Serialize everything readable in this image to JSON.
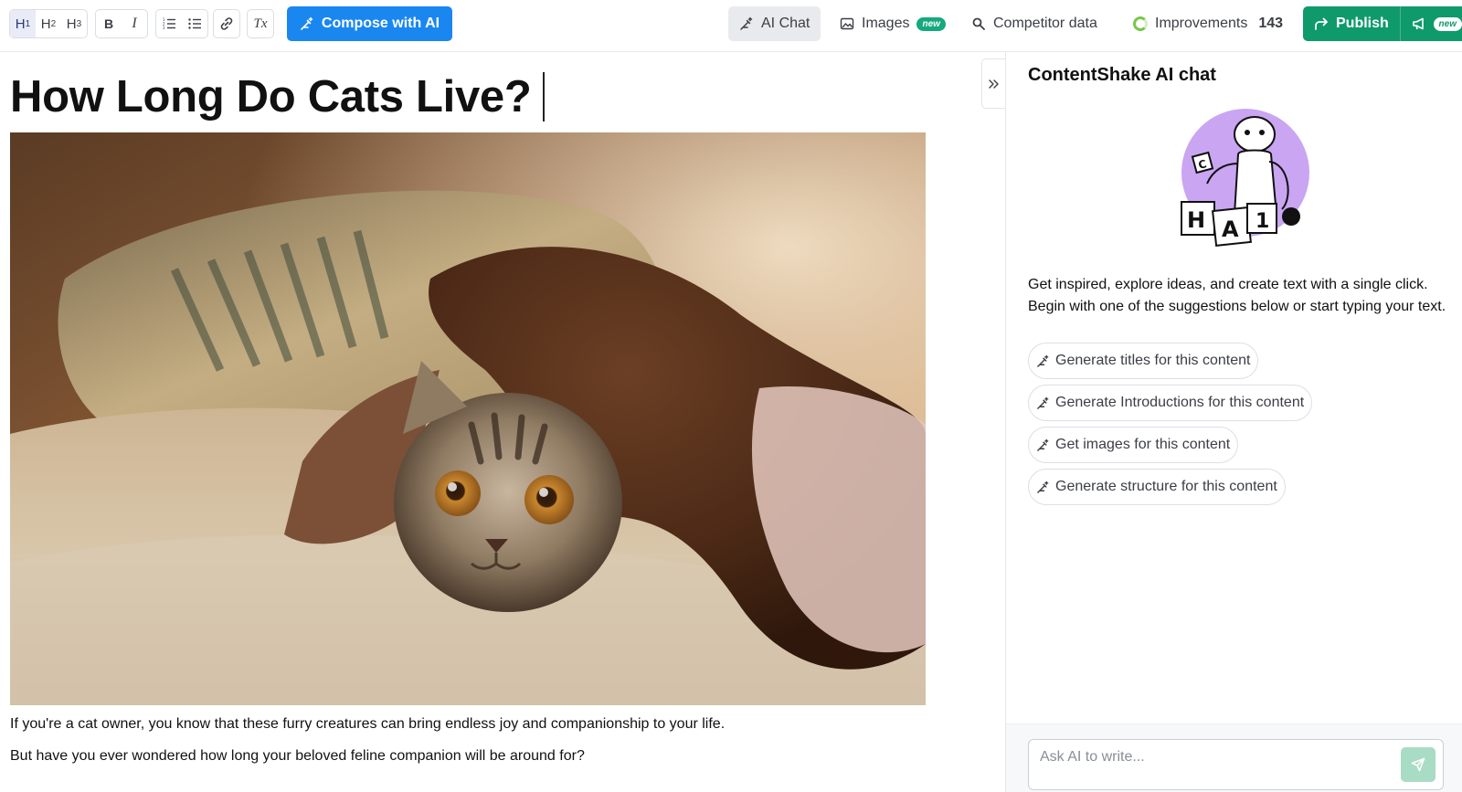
{
  "toolbar": {
    "h1": "H",
    "h1_sub": "1",
    "h2": "H",
    "h2_sub": "2",
    "h3": "H",
    "h3_sub": "3",
    "bold": "B",
    "italic": "I",
    "clear_format": "Tx",
    "compose_label": "Compose with AI",
    "ai_chat_label": "AI Chat",
    "images_label": "Images",
    "images_badge": "new",
    "competitor_label": "Competitor data",
    "improvements_label": "Improvements",
    "improvements_count": "143",
    "publish_label": "Publish",
    "publish_badge": "new"
  },
  "editor": {
    "title": "How Long Do Cats Live?",
    "paragraphs": [
      "If you're a cat owner, you know that these furry creatures can bring endless joy and companionship to your life.",
      "But have you ever wondered how long your beloved feline companion will be around for?"
    ]
  },
  "chat": {
    "title": "ContentShake AI chat",
    "intro": "Get inspired, explore ideas, and create text with a single click. Begin with one of the suggestions below or start typing your text.",
    "suggestions": [
      "Generate titles for this content",
      "Generate Introductions for this content",
      "Get images for this content",
      "Generate structure for this content"
    ],
    "input_placeholder": "Ask AI to write..."
  },
  "colors": {
    "accent_blue": "#1a87f0",
    "publish_green": "#0f9a6b",
    "badge_green": "#16a87e",
    "robot_purple": "#c9a5f2"
  },
  "icons": [
    "heading-icon",
    "bold-icon",
    "italic-icon",
    "ordered-list-icon",
    "bullet-list-icon",
    "link-icon",
    "clear-format-icon",
    "magic-pen-icon",
    "image-icon",
    "search-icon",
    "progress-ring-icon",
    "share-arrow-icon",
    "megaphone-icon",
    "double-chevron-right-icon",
    "send-icon",
    "robot-illustration"
  ]
}
